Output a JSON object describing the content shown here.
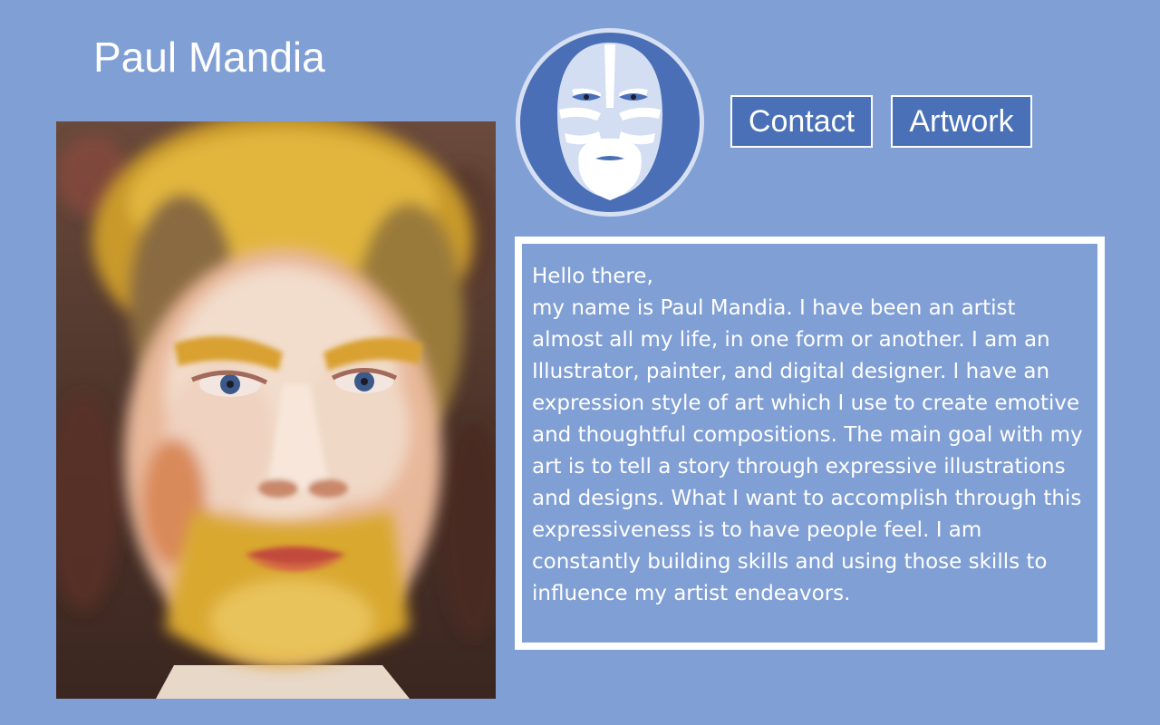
{
  "header": {
    "site_title": "Paul Mandia"
  },
  "nav": {
    "contact_label": "Contact",
    "artwork_label": "Artwork"
  },
  "logo": {
    "icon": "bearded-mask-face-icon"
  },
  "portrait": {
    "icon": "self-portrait-painting"
  },
  "bio": {
    "text": "Hello there,\nmy name is Paul Mandia. I have been an artist almost all my life, in one form or another. I am an Illustrator, painter, and digital designer. I have an expression style of art which I use to create emotive and thoughtful compositions. The main goal with my art is to tell a story through expressive illustrations and designs. What I want to accomplish through this expressiveness is to have people feel. I am constantly building skills and using those skills to influence my artist endeavors."
  },
  "colors": {
    "page_background": "#809fd5",
    "button_background": "#4a70b8",
    "logo_background": "#4a6fb6",
    "text": "#ffffff"
  }
}
